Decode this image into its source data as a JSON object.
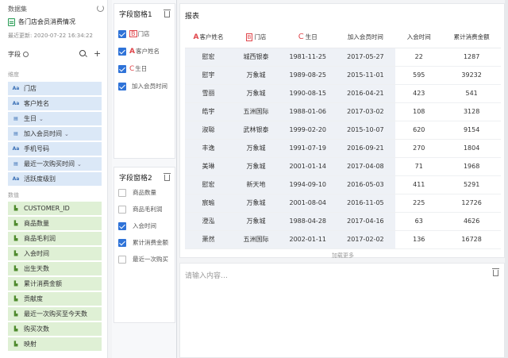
{
  "dataset": {
    "section_title": "数据集",
    "name": "各门店会员消费情况",
    "updated": "最近更新: 2020-07-22 16:34:22"
  },
  "fields_panel": {
    "label": "字段",
    "dimension_label": "维度",
    "measure_label": "数值",
    "dimensions": [
      {
        "icon": "Aa",
        "label": "门店",
        "chevron": false
      },
      {
        "icon": "Aa",
        "label": "客户姓名",
        "chevron": false
      },
      {
        "icon": "▤",
        "label": "生日",
        "chevron": true
      },
      {
        "icon": "▤",
        "label": "加入会员时间",
        "chevron": true
      },
      {
        "icon": "Aa",
        "label": "手机号码",
        "chevron": false
      },
      {
        "icon": "▤",
        "label": "最近一次购买时间",
        "chevron": true
      },
      {
        "icon": "Aa",
        "label": "活跃度级别",
        "chevron": false
      }
    ],
    "measures": [
      {
        "icon": "▮",
        "label": "CUSTOMER_ID"
      },
      {
        "icon": "▮",
        "label": "商品数量"
      },
      {
        "icon": "▮",
        "label": "商品毛利润"
      },
      {
        "icon": "▮",
        "label": "入会时间"
      },
      {
        "icon": "▮",
        "label": "出生天数"
      },
      {
        "icon": "▮",
        "label": "累计消费金额"
      },
      {
        "icon": "▮",
        "label": "贡献度"
      },
      {
        "icon": "▮",
        "label": "最近一次购买至今天数"
      },
      {
        "icon": "▮",
        "label": "购买次数"
      },
      {
        "icon": "▮",
        "label": "映射"
      }
    ]
  },
  "field_grid_1": {
    "title": "字段窗格1",
    "items": [
      {
        "type": "B",
        "label": "门店",
        "checked": true
      },
      {
        "type": "A",
        "label": "客户姓名",
        "checked": true
      },
      {
        "type": "C",
        "label": "生日",
        "checked": true
      },
      {
        "type": "",
        "label": "加入会员时间",
        "checked": true
      }
    ]
  },
  "field_grid_2": {
    "title": "字段窗格2",
    "items": [
      {
        "label": "商品数量",
        "checked": false
      },
      {
        "label": "商品毛利润",
        "checked": false
      },
      {
        "label": "入会时间",
        "checked": true
      },
      {
        "label": "累计消费金额",
        "checked": true
      },
      {
        "label": "最近一次购买",
        "checked": false
      }
    ]
  },
  "report": {
    "title": "报表",
    "columns": [
      {
        "prefix": "A",
        "label": "客户姓名"
      },
      {
        "prefix": "B",
        "label": "门店"
      },
      {
        "prefix": "C",
        "label": "生日"
      },
      {
        "prefix": "",
        "label": "加入会员时间"
      },
      {
        "prefix": "",
        "label": "入会时间"
      },
      {
        "prefix": "",
        "label": "累计消费金额"
      }
    ],
    "rows": [
      [
        "慰宏",
        "城西银泰",
        "1981-11-25",
        "2017-05-27",
        "22",
        "1287"
      ],
      [
        "慰宇",
        "万象城",
        "1989-08-25",
        "2015-11-01",
        "595",
        "39232"
      ],
      [
        "雪丽",
        "万象城",
        "1990-08-15",
        "2016-04-21",
        "423",
        "541"
      ],
      [
        "皓宇",
        "五洲国际",
        "1988-01-06",
        "2017-03-02",
        "108",
        "3128"
      ],
      [
        "淑聪",
        "武林银泰",
        "1999-02-20",
        "2015-10-07",
        "620",
        "9154"
      ],
      [
        "丰逸",
        "万象城",
        "1991-07-19",
        "2016-09-21",
        "270",
        "1804"
      ],
      [
        "美琳",
        "万象城",
        "2001-01-14",
        "2017-04-08",
        "71",
        "1968"
      ],
      [
        "慰宏",
        "新天地",
        "1994-09-10",
        "2016-05-03",
        "411",
        "5291"
      ],
      [
        "宸瑜",
        "万象城",
        "2001-08-04",
        "2016-11-05",
        "225",
        "12726"
      ],
      [
        "澄泓",
        "万象城",
        "1988-04-28",
        "2017-04-16",
        "63",
        "4626"
      ],
      [
        "萧然",
        "五洲国际",
        "2002-01-11",
        "2017-02-02",
        "136",
        "16728"
      ]
    ],
    "load_more": "加载更多"
  },
  "comment": {
    "placeholder": "请输入内容…"
  },
  "colors": {
    "accent": "#2f73d8",
    "dimension_bg": "#dbe8f7",
    "measure_bg": "#dff0d5",
    "type_letter": "#e0474c"
  }
}
